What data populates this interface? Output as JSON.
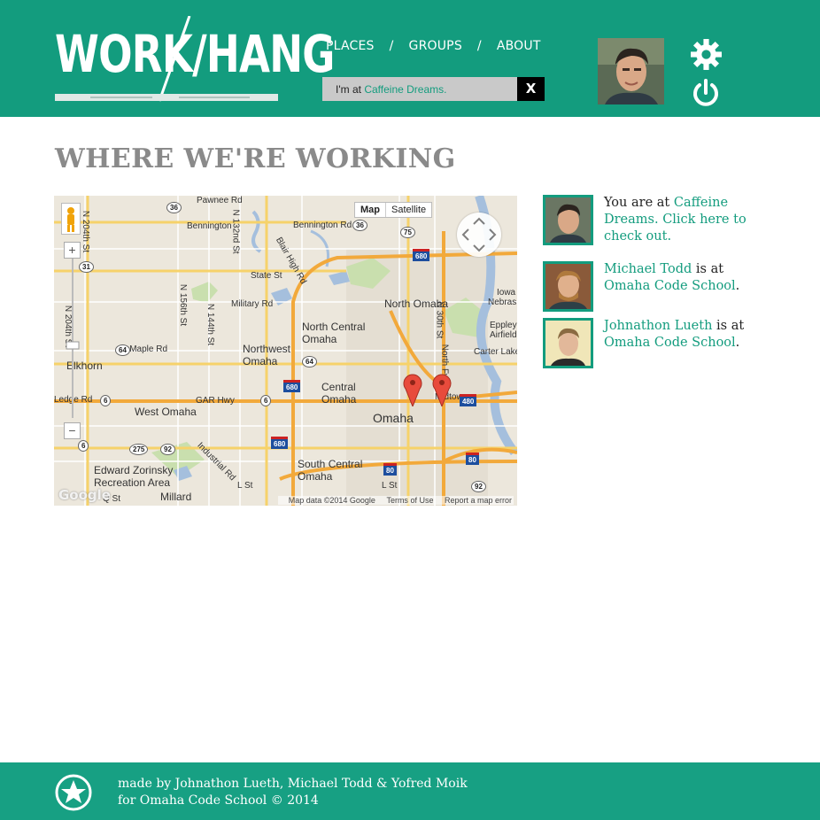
{
  "header": {
    "logo_text": "WORK/HANG",
    "nav": [
      {
        "label": "PLACES"
      },
      {
        "label": "GROUPS"
      },
      {
        "label": "ABOUT"
      }
    ],
    "nav_separator": "/",
    "checkin": {
      "prefix": "I'm at",
      "place": "Caffeine Dreams.",
      "close_label": "X"
    }
  },
  "page_title": "WHERE WE'RE WORKING",
  "map": {
    "type_buttons": [
      "Map",
      "Satellite"
    ],
    "attribution": {
      "data": "Map data ©2014 Google",
      "terms": "Terms of Use",
      "report": "Report a map error"
    },
    "google_logo": "Google",
    "labels": {
      "bennington": "Bennington",
      "pawnee": "Pawnee Rd",
      "state_st": "State St",
      "blair": "Blair High Rd",
      "military": "Military Rd",
      "north_omaha": "North Omaha",
      "ncentral": "North Central Omaha",
      "northwest": "Northwest Omaha",
      "maple": "W Maple Rd",
      "elkhorn": "Elkhorn",
      "central": "Central Omaha",
      "omaha": "Omaha",
      "west_omaha": "West Omaha",
      "gar": "GAR Hwy",
      "midtown": "Midtown",
      "zorinsky": "Edward Zorinsky Recreation Area",
      "industrial": "Industrial Rd",
      "south_central": "South Central Omaha",
      "millard": "Millard",
      "lst": "L St",
      "qst": "Q St",
      "carter": "Carter Lake",
      "eppley": "Eppley Airfield",
      "nebraska": "Nebras",
      "iowa": "Iowa",
      "n204": "N 204th St",
      "n156": "N 156th St",
      "n144": "N 144th St",
      "n132": "N 132nd St",
      "n30": "N 30th St",
      "nfwy": "North Fwy",
      "bennington_rd": "Bennington Rd",
      "ledge": "Ledge Rd"
    },
    "shields": [
      "36",
      "36",
      "75",
      "31",
      "64",
      "64",
      "6",
      "6",
      "6",
      "275",
      "92",
      "50",
      "92"
    ],
    "interstates": [
      "680",
      "680",
      "680",
      "480",
      "80",
      "80"
    ],
    "markers": [
      {
        "name": "Caffeine Dreams"
      },
      {
        "name": "Omaha Code School"
      }
    ]
  },
  "people": [
    {
      "prefix": "You are at ",
      "place": "Caffeine Dreams. Click here to check out.",
      "name": "",
      "suffix": ""
    },
    {
      "name": "Michael Todd",
      "middle": " is at ",
      "place": "Omaha Code School",
      "suffix": "."
    },
    {
      "name": "Johnathon Lueth",
      "middle": " is at ",
      "place": "Omaha Code School",
      "suffix": "."
    }
  ],
  "footer": {
    "line1": "made by Johnathon Lueth, Michael Todd & Yofred Moik",
    "line2": "for Omaha Code School © 2014"
  },
  "colors": {
    "brand": "#139c7e",
    "footer": "#17a083",
    "title": "#8a8a8a",
    "marker": "#e84b3c"
  }
}
